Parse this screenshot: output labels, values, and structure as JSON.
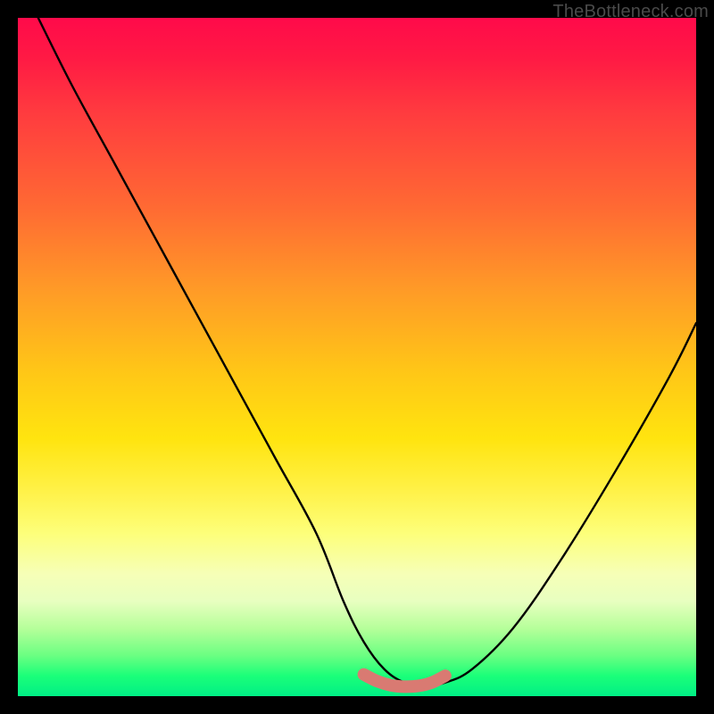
{
  "watermark": "TheBottleneck.com",
  "chart_data": {
    "type": "line",
    "title": "",
    "xlabel": "",
    "ylabel": "",
    "xlim": [
      0,
      100
    ],
    "ylim": [
      0,
      100
    ],
    "grid": false,
    "legend": false,
    "series": [
      {
        "name": "bottleneck-curve",
        "color": "#000000",
        "x": [
          3,
          8,
          14,
          20,
          26,
          32,
          38,
          44,
          48,
          51,
          54,
          57,
          60,
          63,
          67,
          73,
          80,
          88,
          96,
          100
        ],
        "y": [
          100,
          90,
          79,
          68,
          57,
          46,
          35,
          24,
          14,
          8,
          4,
          2,
          1.5,
          2,
          4,
          10,
          20,
          33,
          47,
          55
        ]
      },
      {
        "name": "flat-bottom-highlight",
        "color": "#d97a72",
        "x": [
          51,
          53,
          55,
          57,
          59,
          61,
          63
        ],
        "y": [
          3.2,
          2.2,
          1.6,
          1.4,
          1.5,
          2.0,
          3.0
        ]
      }
    ],
    "annotations": []
  }
}
